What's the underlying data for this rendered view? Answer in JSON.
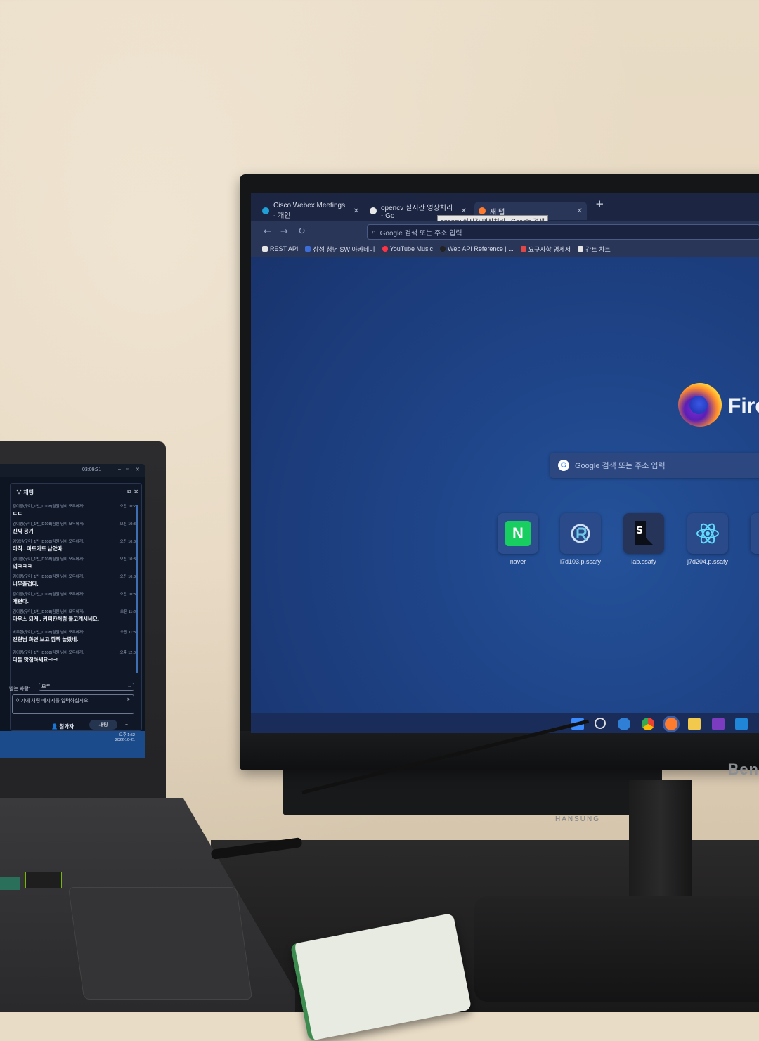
{
  "browser": {
    "tabs": [
      {
        "label": "Cisco Webex Meetings - 개인",
        "active": false
      },
      {
        "label": "opencv 실시간 영상처리 - Go",
        "active": false
      },
      {
        "label": "새 탭",
        "active": true
      }
    ],
    "tooltip": "opencv 실시간 영상처리 - Google 검색",
    "address_placeholder": "Google 검색 또는 주소 입력",
    "bookmarks": [
      "REST API",
      "삼성 청년 SW 아카데미",
      "YouTube Music",
      "Web API Reference | ...",
      "요구사항 명세서",
      "간트 차트"
    ]
  },
  "newtab": {
    "brand_text": "Fire",
    "search_placeholder": "Google 검색 또는 주소 입력",
    "shortcuts": [
      {
        "label": "naver",
        "icon": "naver-icon"
      },
      {
        "label": "i7d103.p.ssafy",
        "icon": "r-logo-icon"
      },
      {
        "label": "lab.ssafy",
        "icon": "s-logo-icon"
      },
      {
        "label": "j7d204.p.ssafy",
        "icon": "react-icon"
      }
    ]
  },
  "monitor": {
    "brand": "Ben",
    "second_brand": "HANSUNG"
  },
  "webex": {
    "time": "03:09:31",
    "chat_title": "채팅",
    "messages": [
      {
        "from": "김이림(구미_1반_D108)팀원 님이 모두에게:",
        "time": "오전 10:26",
        "text": "ㄷㄷ"
      },
      {
        "from": "김이림(구미_1반_D108)팀원 님이 모두에게:",
        "time": "오전 10:30",
        "text": "진짜 공기"
      },
      {
        "from": "임영선(구미_1반_D108)팀원 님이 모두에게:",
        "time": "오전 10:30",
        "text": "아직.. 마트카트 남았따."
      },
      {
        "from": "김이림(구미_1반_D108)팀원 님이 모두에게:",
        "time": "오전 10:30",
        "text": "엌ㅋㅋㅋ"
      },
      {
        "from": "김이림(구미_1반_D108)팀원 님이 모두에게:",
        "time": "오전 10:31",
        "text": "너무즐겁다."
      },
      {
        "from": "김이림(구미_1반_D108)팀원 님이 모두에게:",
        "time": "오전 10:33",
        "text": "개편다."
      },
      {
        "from": "김이림(구미_1반_D108)팀원 님이 모두에게:",
        "time": "오전 11:28",
        "text": "마우스 되게.. 커피잔처럼 들고계시네요."
      },
      {
        "from": "박주현(구미_1반_D108)팀원 님이 모두에게:",
        "time": "오전 11:30",
        "text": "진현님 화면 보고 깜짝 놀랐네."
      },
      {
        "from": "김이림(구미_1반_D108)팀원 님이 모두에게:",
        "time": "오후 12:01",
        "text": "다들 맛점하세요~!~!"
      }
    ],
    "to_label": "받는 사람:",
    "to_value": "모두",
    "input_placeholder": "여기에 채팅 메시지를 입력하십시오.",
    "participants_label": "참가자",
    "chat_button": "채팅",
    "clock_time": "오후 1:52",
    "clock_date": "2022-10-21"
  }
}
